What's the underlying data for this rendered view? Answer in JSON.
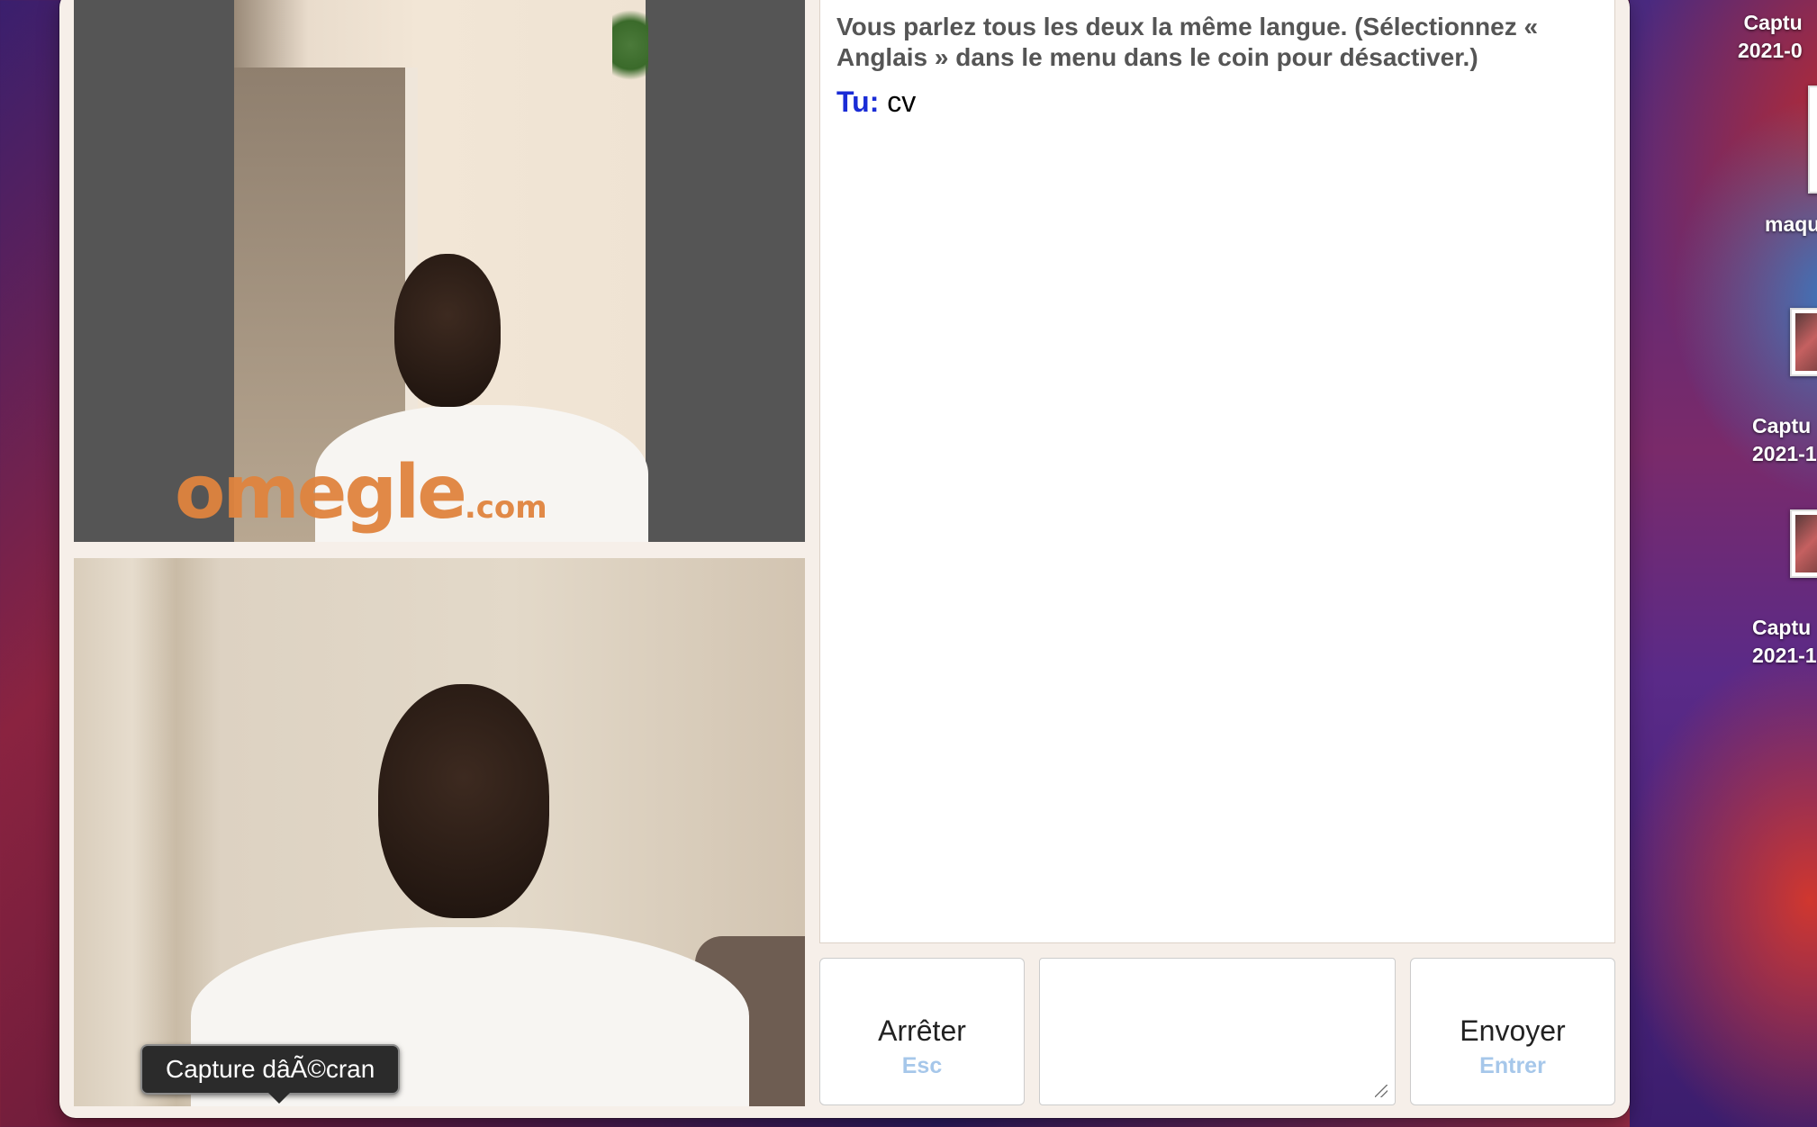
{
  "chat": {
    "status_message": "Vous parlez tous les deux la même langue. (Sélectionnez « Anglais » dans le menu dans le coin pour désactiver.)",
    "you_label": "Tu:",
    "message": "cv"
  },
  "video": {
    "watermark_main": "omegle",
    "watermark_suffix": ".com"
  },
  "buttons": {
    "stop_label": "Arrêter",
    "stop_hint": "Esc",
    "send_label": "Envoyer",
    "send_hint": "Entrer"
  },
  "input": {
    "value": ""
  },
  "tooltip": {
    "text": "Capture dâÃ©cran"
  },
  "desktop": {
    "items": [
      {
        "line1": "Captu",
        "line2": "2021-0"
      },
      {
        "line1": "maqu",
        "line2": ""
      },
      {
        "line1": "Captu",
        "line2": "2021-1"
      },
      {
        "line1": "Captu",
        "line2": "2021-1"
      }
    ]
  }
}
